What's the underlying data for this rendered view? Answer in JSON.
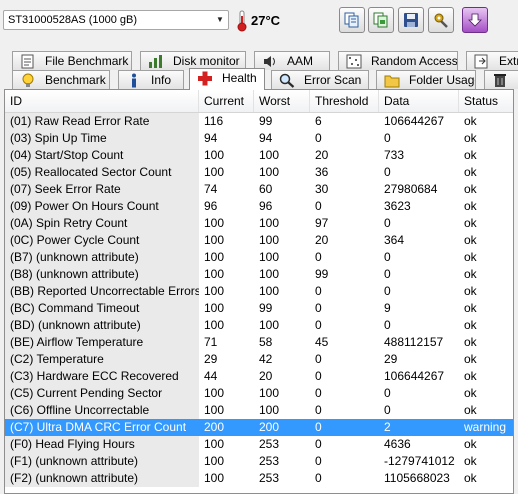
{
  "toolbar": {
    "drive": "ST31000528AS (1000 gB)",
    "temperature": "27°C"
  },
  "tabs_back": [
    {
      "label": "File Benchmark",
      "icon": "file-benchmark-icon"
    },
    {
      "label": "Disk monitor",
      "icon": "disk-monitor-icon"
    },
    {
      "label": "AAM",
      "icon": "speaker-icon"
    },
    {
      "label": "Random Access",
      "icon": "random-access-icon"
    },
    {
      "label": "Extra",
      "icon": "extra-icon"
    }
  ],
  "tabs_front": [
    {
      "label": "Benchmark",
      "icon": "lightbulb-icon"
    },
    {
      "label": "Info",
      "icon": "info-icon"
    },
    {
      "label": "Health",
      "icon": "health-cross-icon"
    },
    {
      "label": "Error Scan",
      "icon": "magnifier-icon"
    },
    {
      "label": "Folder Usage",
      "icon": "folder-icon"
    },
    {
      "label": "",
      "icon": "trash-icon"
    }
  ],
  "selected_tab": "Health",
  "columns": [
    "ID",
    "Current",
    "Worst",
    "Threshold",
    "Data",
    "Status"
  ],
  "rows": [
    [
      "(01) Raw Read Error Rate",
      "116",
      "99",
      "6",
      "106644267",
      "ok"
    ],
    [
      "(03) Spin Up Time",
      "94",
      "94",
      "0",
      "0",
      "ok"
    ],
    [
      "(04) Start/Stop Count",
      "100",
      "100",
      "20",
      "733",
      "ok"
    ],
    [
      "(05) Reallocated Sector Count",
      "100",
      "100",
      "36",
      "0",
      "ok"
    ],
    [
      "(07) Seek Error Rate",
      "74",
      "60",
      "30",
      "27980684",
      "ok"
    ],
    [
      "(09) Power On Hours Count",
      "96",
      "96",
      "0",
      "3623",
      "ok"
    ],
    [
      "(0A) Spin Retry Count",
      "100",
      "100",
      "97",
      "0",
      "ok"
    ],
    [
      "(0C) Power Cycle Count",
      "100",
      "100",
      "20",
      "364",
      "ok"
    ],
    [
      "(B7) (unknown attribute)",
      "100",
      "100",
      "0",
      "0",
      "ok"
    ],
    [
      "(B8) (unknown attribute)",
      "100",
      "100",
      "99",
      "0",
      "ok"
    ],
    [
      "(BB) Reported Uncorrectable Errors",
      "100",
      "100",
      "0",
      "0",
      "ok"
    ],
    [
      "(BC) Command Timeout",
      "100",
      "99",
      "0",
      "9",
      "ok"
    ],
    [
      "(BD) (unknown attribute)",
      "100",
      "100",
      "0",
      "0",
      "ok"
    ],
    [
      "(BE) Airflow Temperature",
      "71",
      "58",
      "45",
      "488112157",
      "ok"
    ],
    [
      "(C2) Temperature",
      "29",
      "42",
      "0",
      "29",
      "ok"
    ],
    [
      "(C3) Hardware ECC Recovered",
      "44",
      "20",
      "0",
      "106644267",
      "ok"
    ],
    [
      "(C5) Current Pending Sector",
      "100",
      "100",
      "0",
      "0",
      "ok"
    ],
    [
      "(C6) Offline Uncorrectable",
      "100",
      "100",
      "0",
      "0",
      "ok"
    ],
    [
      "(C7) Ultra DMA CRC Error Count",
      "200",
      "200",
      "0",
      "2",
      "warning"
    ],
    [
      "(F0) Head Flying Hours",
      "100",
      "253",
      "0",
      "4636",
      "ok"
    ],
    [
      "(F1) (unknown attribute)",
      "100",
      "253",
      "0",
      "-1279741012",
      "ok"
    ],
    [
      "(F2) (unknown attribute)",
      "100",
      "253",
      "0",
      "1105668023",
      "ok"
    ]
  ],
  "colors": {
    "selection": "#3399ff",
    "id_column_bg": "#eaeaea",
    "temperature_icon": "#d11f1f",
    "health_icon": "#d32020"
  }
}
